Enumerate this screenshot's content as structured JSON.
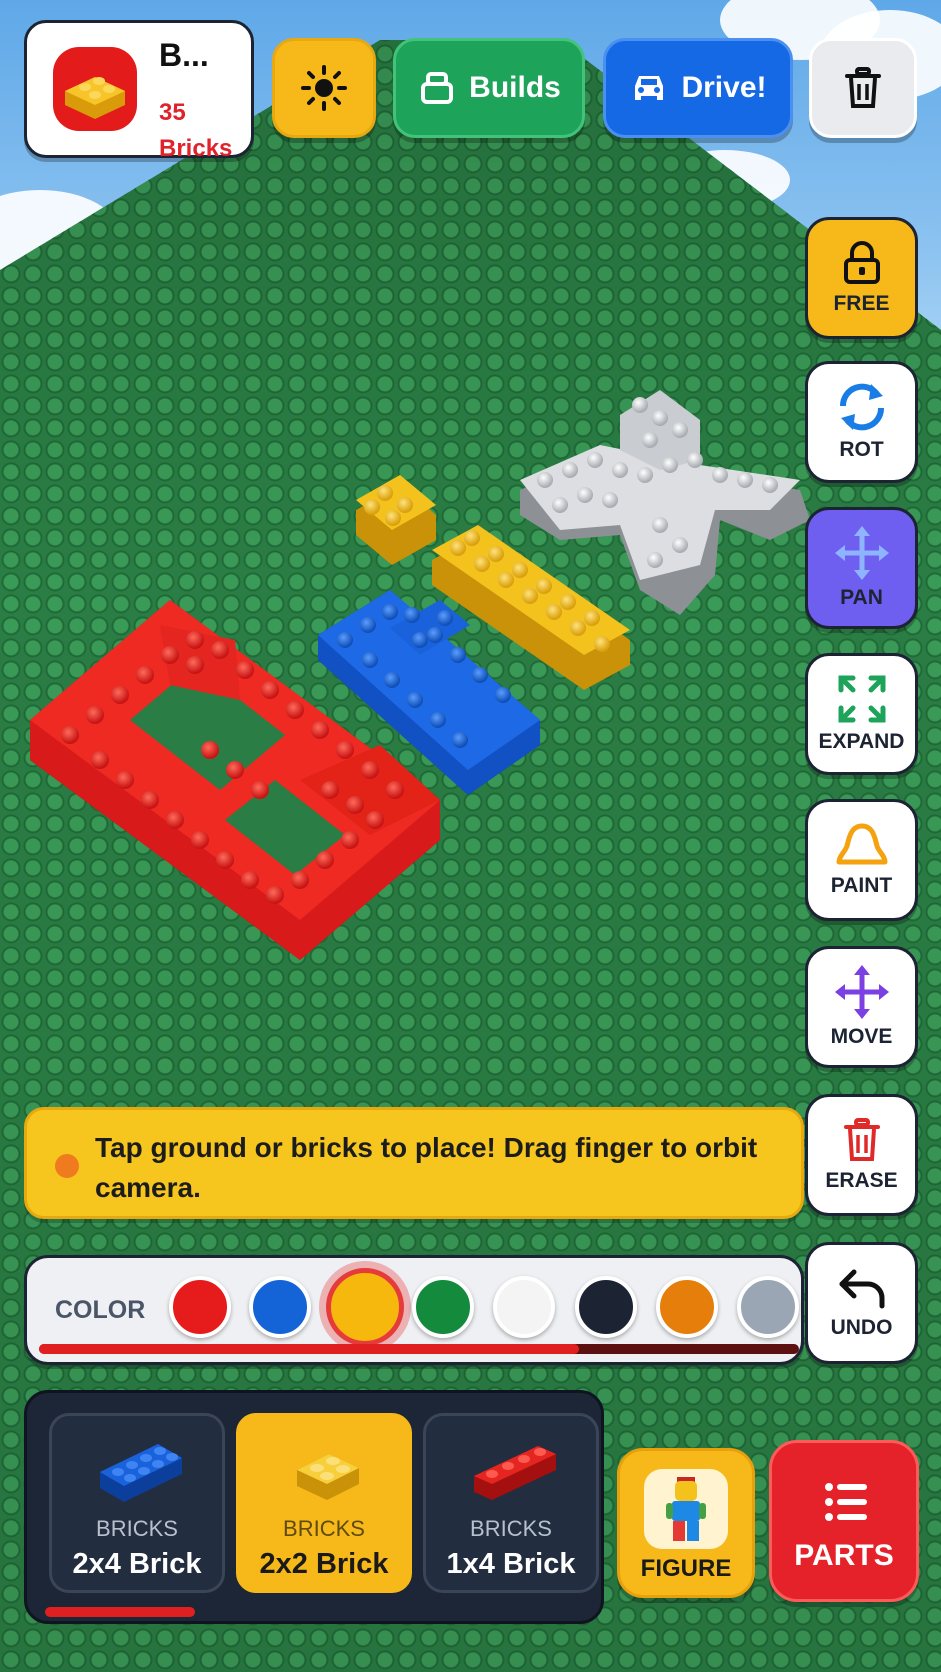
{
  "header": {
    "title": "B...",
    "brick_count": "35",
    "brick_unit": "Bricks",
    "builds_label": "Builds",
    "drive_label": "Drive!"
  },
  "tools": [
    {
      "id": "free",
      "label": "FREE",
      "icon": "lock-icon"
    },
    {
      "id": "rot",
      "label": "ROT",
      "icon": "rotate-icon"
    },
    {
      "id": "pan",
      "label": "PAN",
      "icon": "pan-arrows-icon"
    },
    {
      "id": "expand",
      "label": "EXPAND",
      "icon": "expand-icon"
    },
    {
      "id": "paint",
      "label": "PAINT",
      "icon": "paint-blob-icon"
    },
    {
      "id": "move",
      "label": "MOVE",
      "icon": "move-arrows-icon"
    },
    {
      "id": "erase",
      "label": "ERASE",
      "icon": "trash-icon"
    },
    {
      "id": "undo",
      "label": "UNDO",
      "icon": "undo-icon"
    }
  ],
  "hint": {
    "text": "Tap ground or bricks to place! Drag finger to orbit camera."
  },
  "colors": {
    "label": "COLOR",
    "swatches": [
      "#e61b1b",
      "#1464d8",
      "#f7b80d",
      "#138a3c",
      "#f4f4f4",
      "#1c2433",
      "#e67e0c",
      "#9aa6b4"
    ],
    "selected_index": 2
  },
  "bricks": [
    {
      "category": "BRICKS",
      "name": "2x4 Brick",
      "color": "#1464d8"
    },
    {
      "category": "BRICKS",
      "name": "2x2 Brick",
      "color": "#f7c21f",
      "active": true
    },
    {
      "category": "BRICKS",
      "name": "1x4 Brick",
      "color": "#e61b1b"
    }
  ],
  "buttons": {
    "figure_label": "FIGURE",
    "parts_label": "PARTS"
  }
}
